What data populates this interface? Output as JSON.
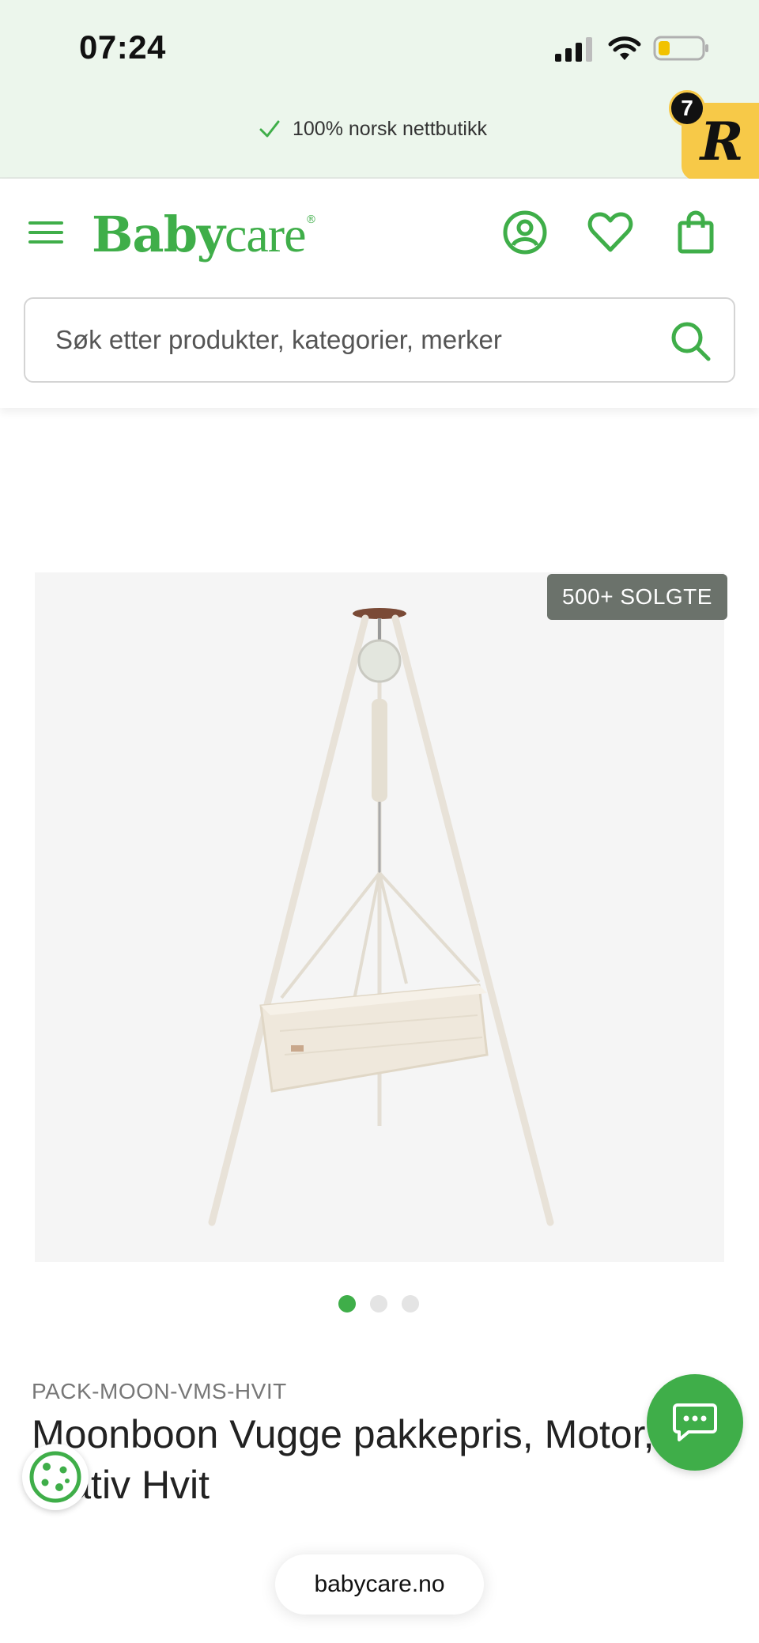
{
  "status_bar": {
    "time": "07:24"
  },
  "promo": {
    "text": "100% norsk nettbutikk",
    "check_icon": "check-icon"
  },
  "rewards_badge": {
    "letter": "R",
    "count": "7"
  },
  "header": {
    "logo_bold": "Baby",
    "logo_light": "care",
    "logo_mark": "®",
    "icons": [
      "menu-icon",
      "account-icon",
      "heart-icon",
      "bag-icon"
    ]
  },
  "search": {
    "placeholder": "Søk etter produkter, kategorier, merker"
  },
  "product": {
    "badge": "500+ SOLGTE",
    "sku": "PACK-MOON-VMS-HVIT",
    "title": "Moonboon Vugge pakkepris, Motor, Stativ Hvit",
    "image_count": 3,
    "active_image": 1
  },
  "browser": {
    "url": "babycare.no"
  },
  "colors": {
    "brand_green": "#3fae49",
    "promo_bg": "#ecf6ec",
    "badge_bg": "#6b726b",
    "rewards_bg": "#f7c948"
  }
}
